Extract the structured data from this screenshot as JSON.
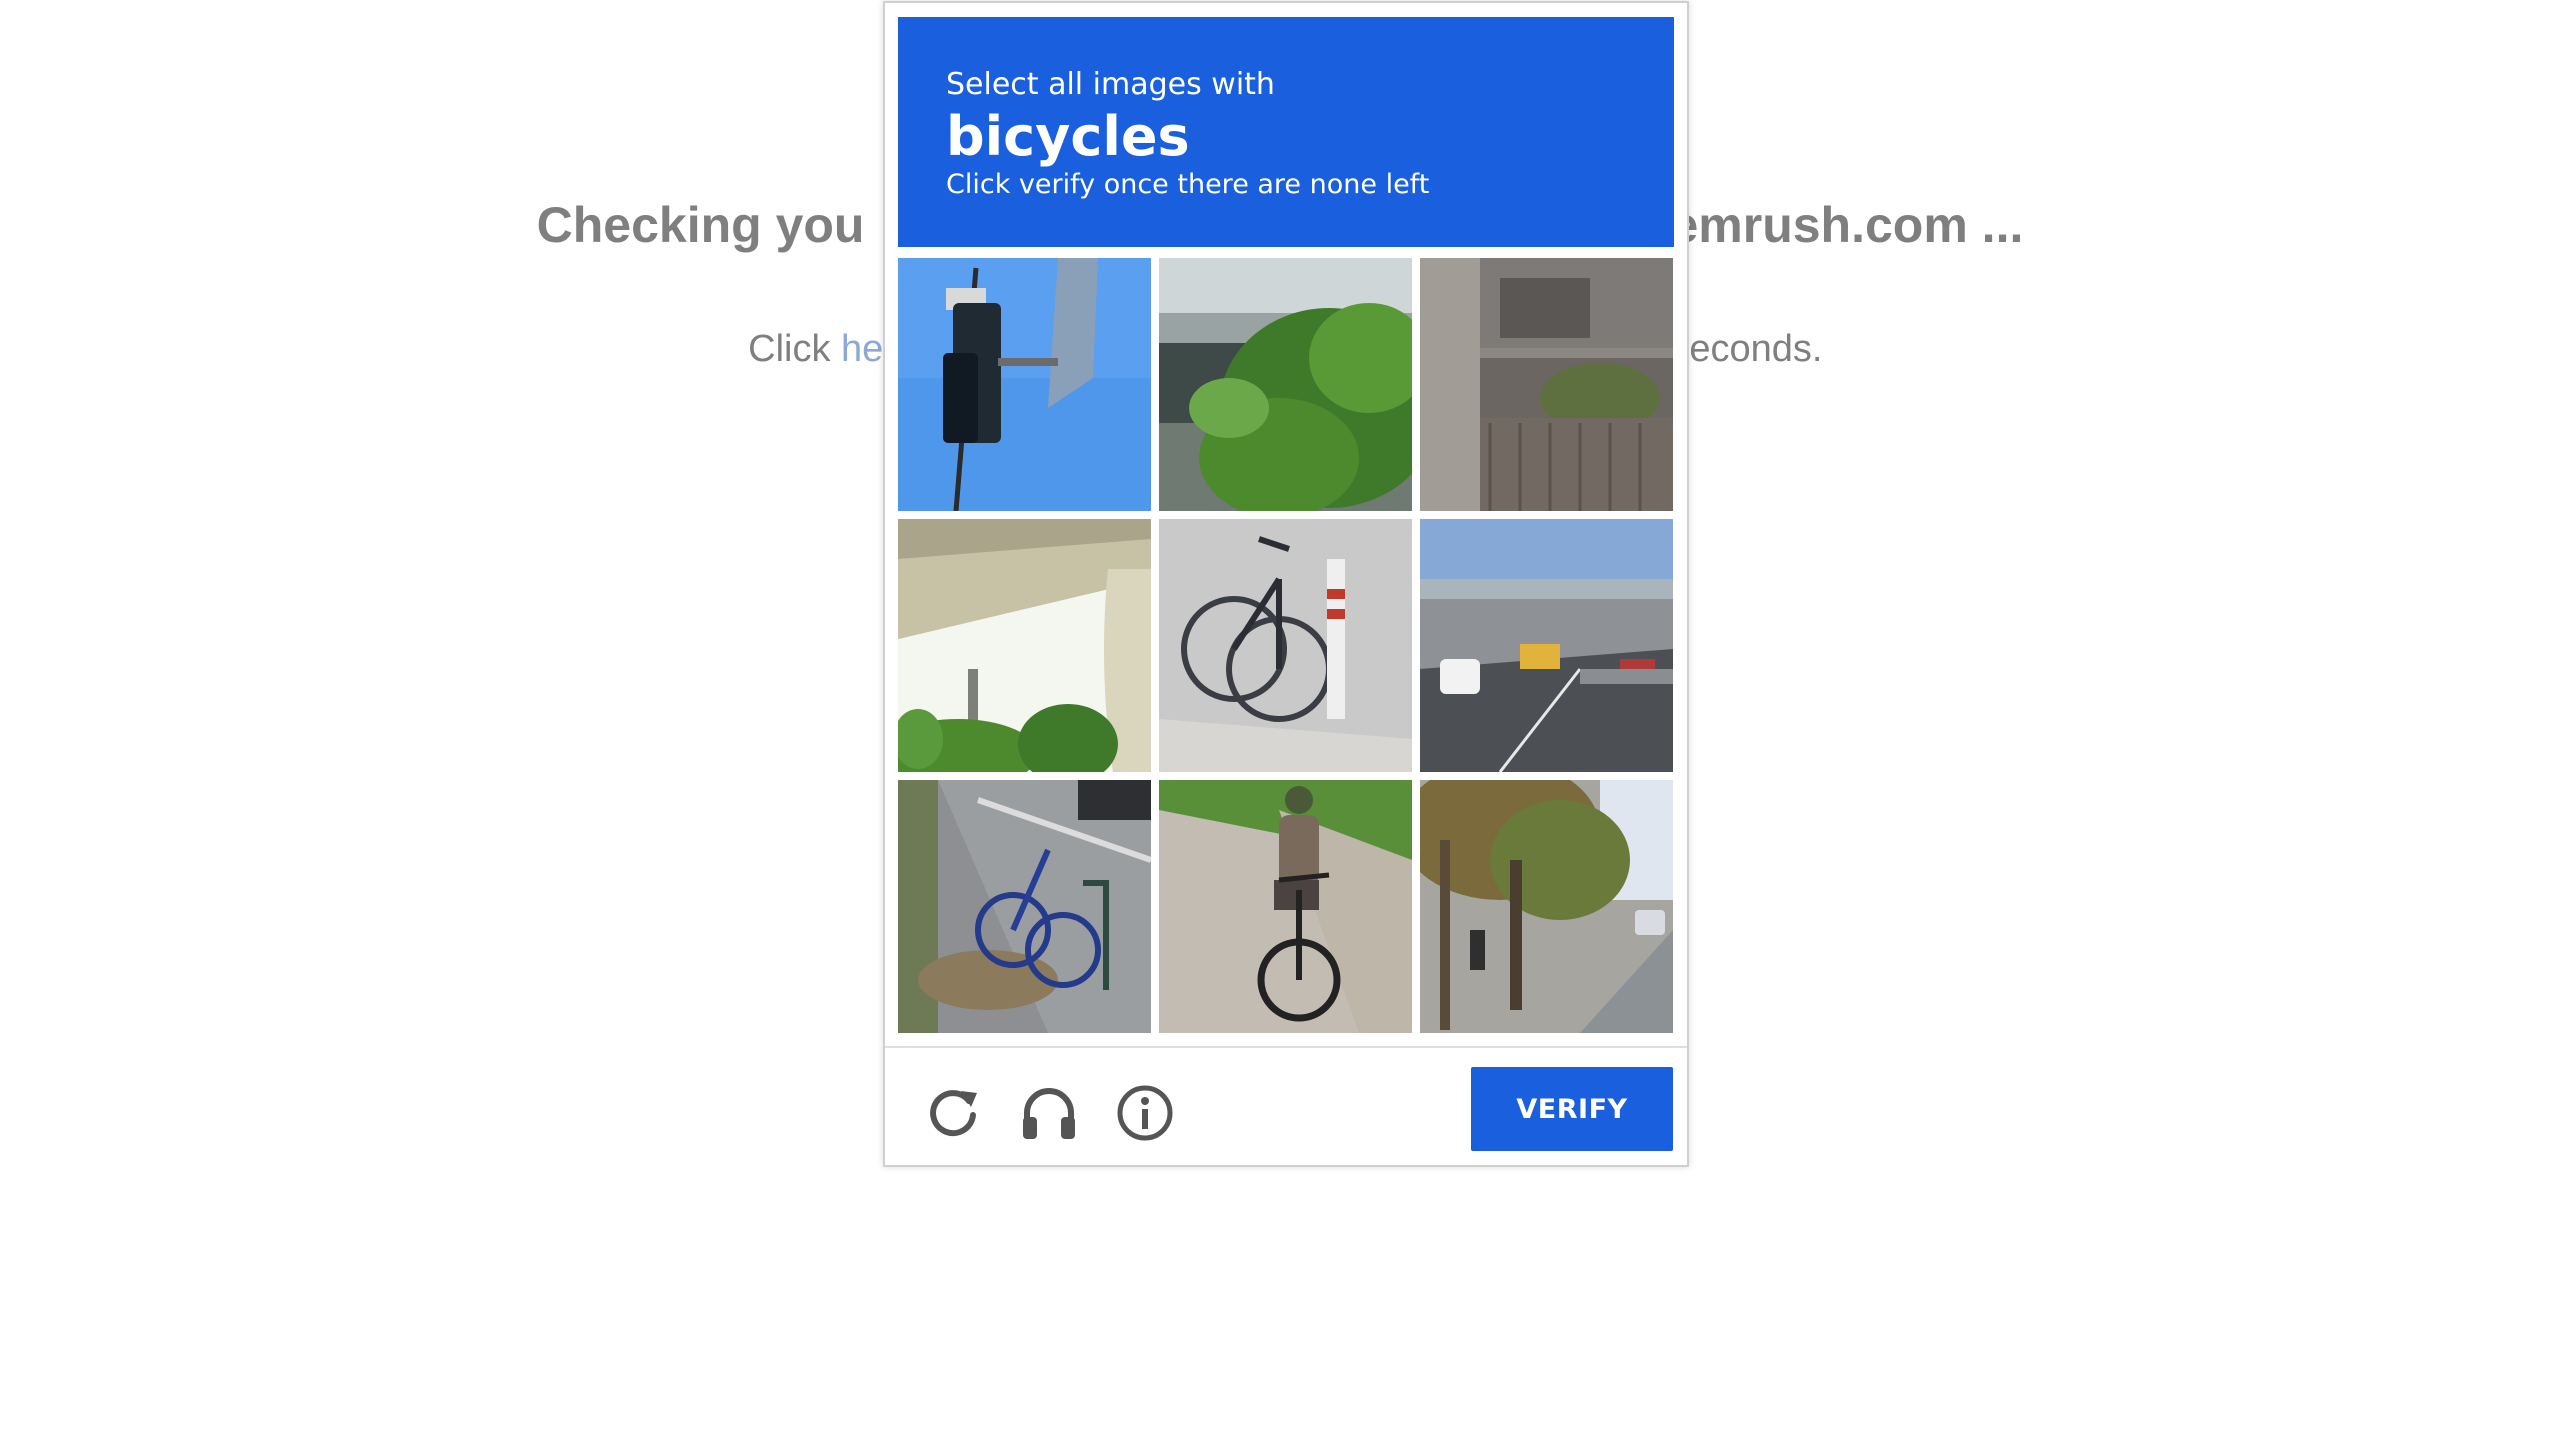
{
  "background": {
    "heading_left": "Checking you",
    "heading_right": "emrush.com ...",
    "sub_prefix": "Click ",
    "sub_link": "he",
    "sub_suffix": "econds."
  },
  "captcha": {
    "instruction": "Select all images with",
    "keyword": "bicycles",
    "hint": "Click verify once there are none left",
    "tiles": [
      {
        "content": "traffic signal"
      },
      {
        "content": "overpass with trees"
      },
      {
        "content": "building facade"
      },
      {
        "content": "overpass underside"
      },
      {
        "content": "bicycle by post"
      },
      {
        "content": "road with vehicles"
      },
      {
        "content": "bicycle at rail"
      },
      {
        "content": "person riding bicycle"
      },
      {
        "content": "sidewalk with trees"
      }
    ],
    "footer": {
      "reload_icon": "reload-icon",
      "audio_icon": "headphones-icon",
      "info_icon": "info-icon",
      "verify_label": "VERIFY"
    },
    "accent_color": "#1a5fde"
  }
}
